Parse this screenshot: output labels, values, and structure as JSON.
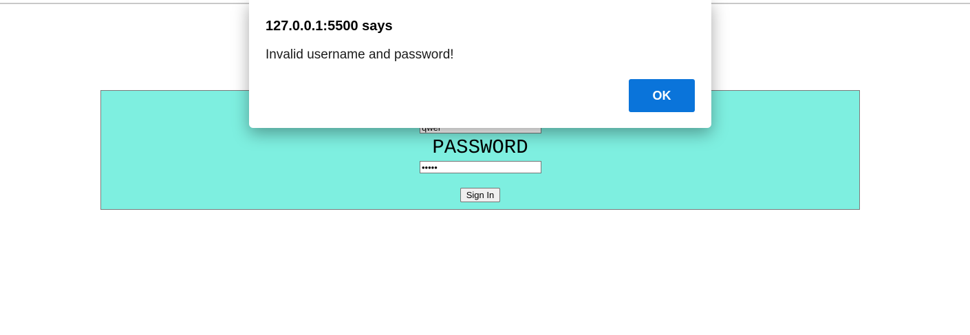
{
  "login_form": {
    "username_value": "qwer",
    "password_label": "PASSWORD",
    "password_value": "•••••",
    "signin_label": "Sign In"
  },
  "alert": {
    "title": "127.0.0.1:5500 says",
    "message": "Invalid username and password!",
    "ok_label": "OK"
  },
  "colors": {
    "panel_background": "#7eefe0",
    "ok_button": "#0a74da"
  }
}
